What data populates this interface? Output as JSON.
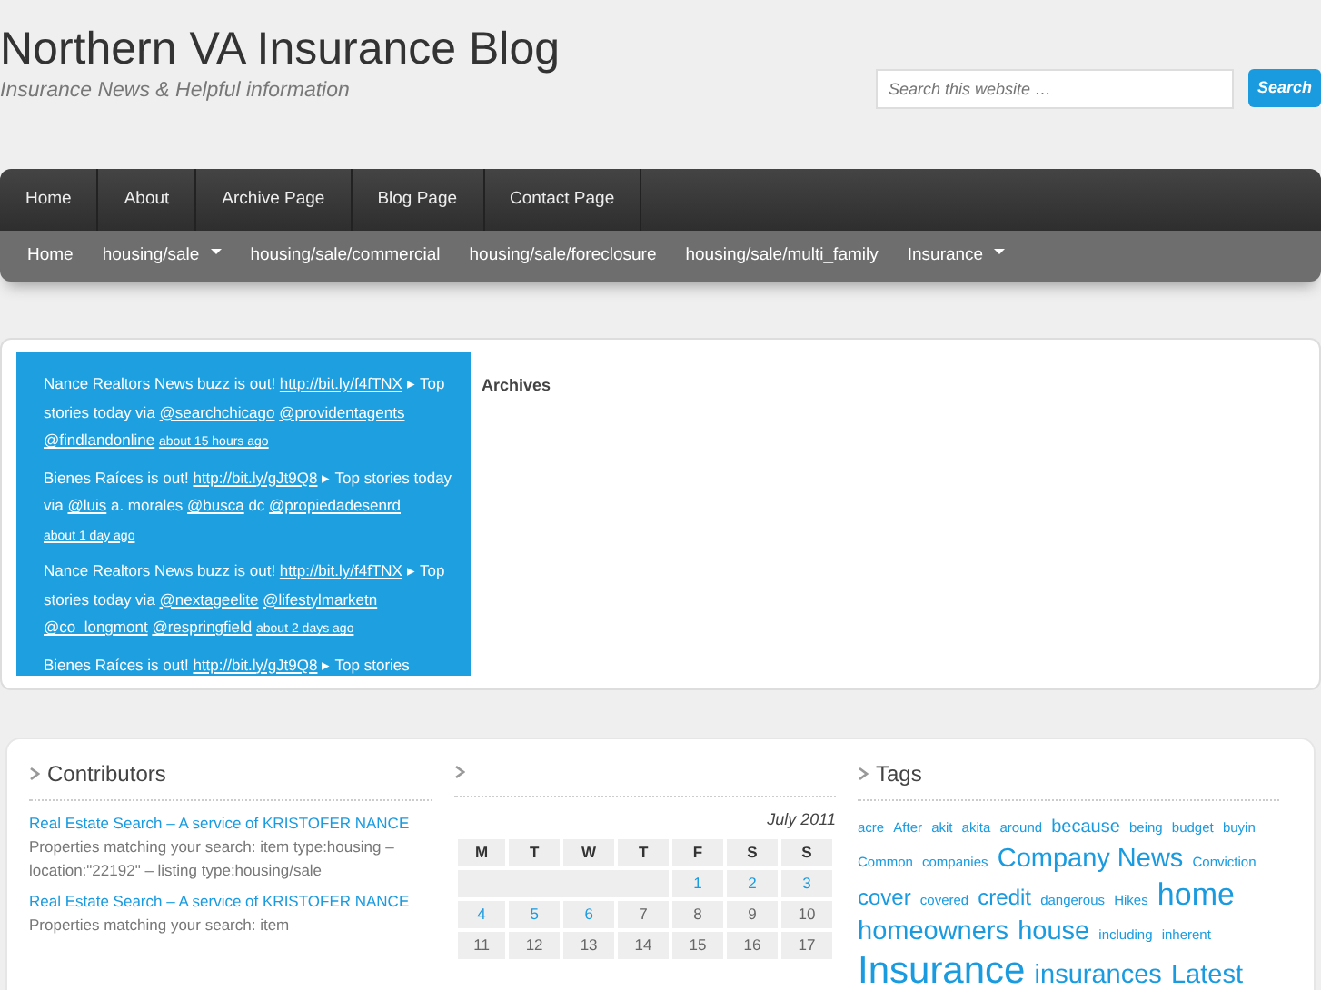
{
  "site": {
    "title": "Northern VA Insurance Blog",
    "tagline": "Insurance News & Helpful information"
  },
  "search": {
    "placeholder": "Search this website …",
    "button": "Search"
  },
  "primary_nav": [
    {
      "label": "Home"
    },
    {
      "label": "About"
    },
    {
      "label": "Archive Page"
    },
    {
      "label": "Blog Page"
    },
    {
      "label": "Contact Page"
    }
  ],
  "secondary_nav": [
    {
      "label": "Home",
      "dropdown": false
    },
    {
      "label": "housing/sale",
      "dropdown": true
    },
    {
      "label": "housing/sale/commercial",
      "dropdown": false
    },
    {
      "label": "housing/sale/foreclosure",
      "dropdown": false
    },
    {
      "label": "housing/sale/multi_family",
      "dropdown": false
    },
    {
      "label": "Insurance",
      "dropdown": true
    }
  ],
  "tweets": [
    [
      {
        "kind": "plain",
        "text": "Nance Realtors News buzz is out! "
      },
      {
        "kind": "link",
        "text": "http://bit.ly/f4fTNX"
      },
      {
        "kind": "plain",
        "text": " ▸ Top stories today via "
      },
      {
        "kind": "link",
        "text": "@searchchicago"
      },
      {
        "kind": "link",
        "text": "@providentagents"
      },
      {
        "kind": "link",
        "text": "@findlandonline"
      },
      {
        "kind": "time",
        "text": "about 15 hours ago"
      }
    ],
    [
      {
        "kind": "plain",
        "text": "Bienes Raíces is out! "
      },
      {
        "kind": "link",
        "text": "http://bit.ly/gJt9Q8"
      },
      {
        "kind": "plain",
        "text": " ▸ Top stories today via "
      },
      {
        "kind": "link",
        "text": "@luis"
      },
      {
        "kind": "plain",
        "text": " a. morales "
      },
      {
        "kind": "link",
        "text": "@busca"
      },
      {
        "kind": "plain",
        "text": " dc "
      },
      {
        "kind": "link",
        "text": "@propiedadesenrd"
      },
      {
        "kind": "time",
        "text": "about 1 day ago"
      }
    ],
    [
      {
        "kind": "plain",
        "text": "Nance Realtors News buzz is out! "
      },
      {
        "kind": "link",
        "text": "http://bit.ly/f4fTNX"
      },
      {
        "kind": "plain",
        "text": " ▸ Top stories today via "
      },
      {
        "kind": "link",
        "text": "@nextageelite"
      },
      {
        "kind": "link",
        "text": "@lifestylmarketn"
      },
      {
        "kind": "link",
        "text": "@co_longmont"
      },
      {
        "kind": "link",
        "text": "@respringfield"
      },
      {
        "kind": "time",
        "text": "about 2 days ago"
      }
    ],
    [
      {
        "kind": "plain",
        "text": "Bienes Raíces is out! "
      },
      {
        "kind": "link",
        "text": "http://bit.ly/gJt9Q8"
      },
      {
        "kind": "plain",
        "text": " ▸ Top stories"
      }
    ]
  ],
  "archives": {
    "title": "Archives"
  },
  "contributors": {
    "title": "Contributors",
    "items": [
      {
        "link": "Real Estate Search – A service of KRISTOFER NANCE",
        "text": "Properties matching your search: item type:housing – location:\"22192\" – listing type:housing/sale"
      },
      {
        "link": "Real Estate Search – A service of KRISTOFER NANCE",
        "text": "Properties matching your search: item"
      }
    ]
  },
  "calendar": {
    "caption": "July 2011",
    "headers": [
      "M",
      "T",
      "W",
      "T",
      "F",
      "S",
      "S"
    ],
    "weeks": [
      [
        {
          "day": "1",
          "linked": true
        },
        {
          "day": "2",
          "linked": true
        },
        {
          "day": "3",
          "linked": true
        }
      ],
      [
        {
          "day": "4",
          "linked": true
        },
        {
          "day": "5",
          "linked": true
        },
        {
          "day": "6",
          "linked": true
        },
        {
          "day": "7",
          "linked": false
        },
        {
          "day": "8",
          "linked": false
        },
        {
          "day": "9",
          "linked": false
        },
        {
          "day": "10",
          "linked": false
        }
      ],
      [
        {
          "day": "11",
          "linked": false
        },
        {
          "day": "12",
          "linked": false
        },
        {
          "day": "13",
          "linked": false
        },
        {
          "day": "14",
          "linked": false
        },
        {
          "day": "15",
          "linked": false
        },
        {
          "day": "16",
          "linked": false
        },
        {
          "day": "17",
          "linked": false
        }
      ]
    ]
  },
  "tags": {
    "title": "Tags",
    "items": [
      {
        "text": "acre",
        "kind": "xs"
      },
      {
        "text": "After",
        "kind": "xs"
      },
      {
        "text": "akit",
        "kind": "xs"
      },
      {
        "text": "akita",
        "kind": "xs"
      },
      {
        "text": "around",
        "kind": "xs"
      },
      {
        "text": "because",
        "kind": "s"
      },
      {
        "text": "being",
        "kind": "xs"
      },
      {
        "text": "budget",
        "kind": "xs"
      },
      {
        "text": "buyin",
        "kind": "xs"
      },
      {
        "text": "Common",
        "kind": "xs"
      },
      {
        "text": "companies",
        "kind": "xs"
      },
      {
        "text": "Company News",
        "kind": "l"
      },
      {
        "text": "Conviction",
        "kind": "xs"
      },
      {
        "text": "cover",
        "kind": "m"
      },
      {
        "text": "covered",
        "kind": "xs"
      },
      {
        "text": "credit",
        "kind": "m"
      },
      {
        "text": "dangerous",
        "kind": "xs"
      },
      {
        "text": "Hikes",
        "kind": "xs"
      },
      {
        "text": "home",
        "kind": "xl"
      },
      {
        "text": "homeowners",
        "kind": "l"
      },
      {
        "text": "house",
        "kind": "l"
      },
      {
        "text": "including",
        "kind": "xs"
      },
      {
        "text": "inherent",
        "kind": "xs"
      },
      {
        "text": "Insurance",
        "kind": "xxl"
      },
      {
        "text": "insurances",
        "kind": "l"
      },
      {
        "text": "Latest",
        "kind": "l"
      }
    ]
  }
}
